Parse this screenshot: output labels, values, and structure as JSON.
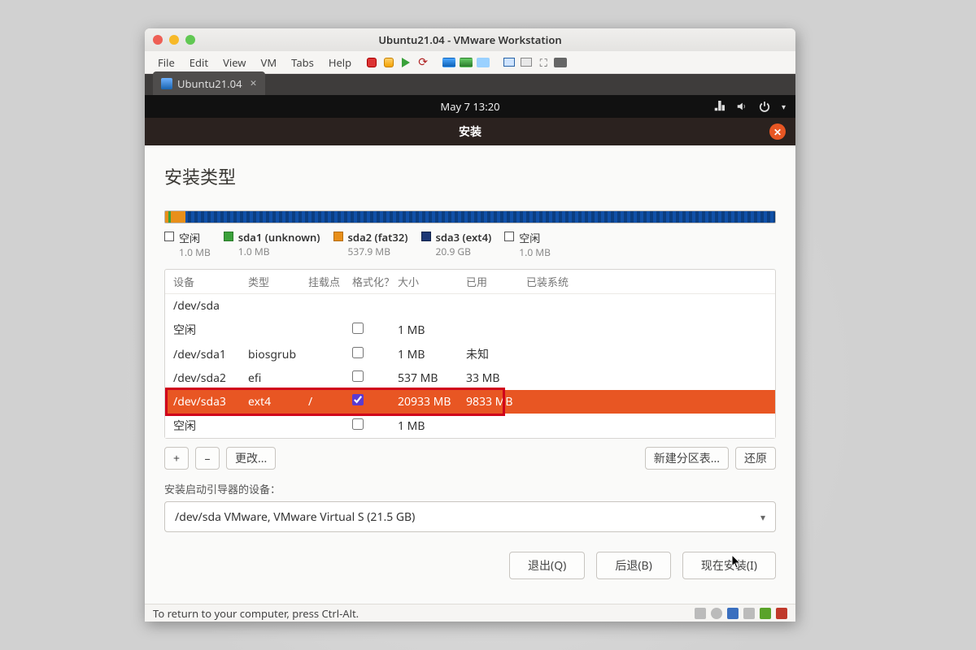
{
  "window": {
    "title": "Ubuntu21.04 - VMware Workstation",
    "menu": [
      "File",
      "Edit",
      "View",
      "VM",
      "Tabs",
      "Help"
    ],
    "tab_label": "Ubuntu21.04",
    "status_text": "To return to your computer, press Ctrl-Alt."
  },
  "gnome": {
    "clock": "May 7  13:20"
  },
  "installer": {
    "title": "安装",
    "heading": "安装类型",
    "legend": [
      {
        "label": "空闲",
        "sub": "1.0 MB",
        "cls": "free"
      },
      {
        "label": "sda1 (unknown)",
        "sub": "1.0 MB",
        "cls": "green"
      },
      {
        "label": "sda2 (fat32)",
        "sub": "537.9 MB",
        "cls": "orange"
      },
      {
        "label": "sda3 (ext4)",
        "sub": "20.9 GB",
        "cls": "blue"
      },
      {
        "label": "空闲",
        "sub": "1.0 MB",
        "cls": "free"
      }
    ],
    "table_headers": {
      "dev": "设备",
      "type": "类型",
      "mount": "挂载点",
      "fmt": "格式化？",
      "size": "大小",
      "used": "已用",
      "sys": "已装系统"
    },
    "rows": [
      {
        "dev": "/dev/sda",
        "type": "",
        "mount": "",
        "fmt": null,
        "size": "",
        "used": "",
        "sel": false
      },
      {
        "dev": "空闲",
        "type": "",
        "mount": "",
        "fmt": false,
        "size": "1 MB",
        "used": "",
        "sel": false
      },
      {
        "dev": "/dev/sda1",
        "type": "biosgrub",
        "mount": "",
        "fmt": false,
        "size": "1 MB",
        "used": "未知",
        "sel": false
      },
      {
        "dev": "/dev/sda2",
        "type": "efi",
        "mount": "",
        "fmt": false,
        "size": "537 MB",
        "used": "33 MB",
        "sel": false
      },
      {
        "dev": "/dev/sda3",
        "type": "ext4",
        "mount": "/",
        "fmt": true,
        "size": "20933 MB",
        "used": "9833 MB",
        "sel": true
      },
      {
        "dev": "空闲",
        "type": "",
        "mount": "",
        "fmt": false,
        "size": "1 MB",
        "used": "",
        "sel": false
      }
    ],
    "buttons": {
      "add": "+",
      "remove": "–",
      "change": "更改...",
      "newtable": "新建分区表...",
      "revert": "还原"
    },
    "boot_label": "安装启动引导器的设备：",
    "boot_select": "/dev/sda   VMware, VMware Virtual S (21.5 GB)",
    "footer": {
      "quit": "退出(Q)",
      "back": "后退(B)",
      "install": "现在安装(I)"
    }
  }
}
